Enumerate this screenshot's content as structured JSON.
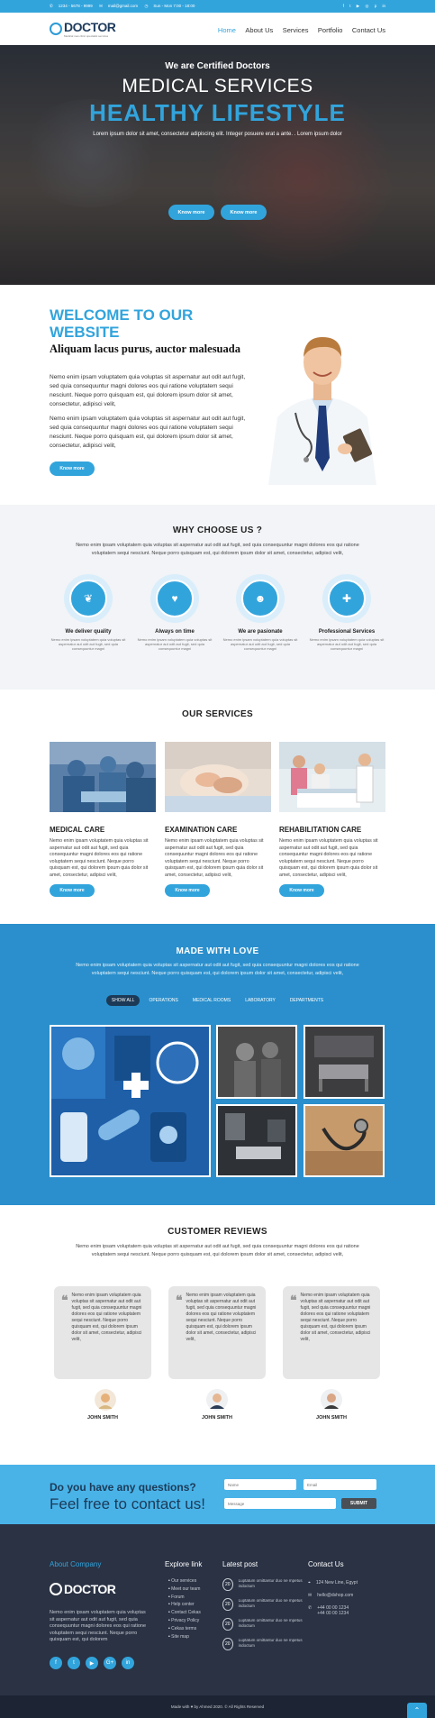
{
  "topbar": {
    "phone": "1234 - 5678 - 9999",
    "email": "mail@gmail.com",
    "hours": "Sun - Mon 7:00 - 18:00",
    "social_icons": [
      "facebook-icon",
      "twitter-icon",
      "youtube-icon",
      "instagram-icon",
      "pinterest-icon",
      "linkedin-icon"
    ]
  },
  "nav": {
    "logo": "DOCTOR",
    "logo_sub": "Medical new clinic specialist services",
    "items": [
      "Home",
      "About Us",
      "Services",
      "Portfolio",
      "Contact Us"
    ],
    "active": "Home"
  },
  "hero": {
    "kicker": "We are Certified Doctors",
    "title": "MEDICAL SERVICES",
    "title2": "HEALTHY LIFESTYLE",
    "text": "Lorem ipsum dolor sit amet, consectetur adipiscing elit. Integer posuere erat a ante. . Lorem ipsum dolor",
    "btn1": "Know more",
    "btn2": "Know more"
  },
  "welcome": {
    "title": "WELCOME TO OUR WEBSITE",
    "subtitle": "Aliquam lacus purus, auctor malesuada",
    "p1": "Nemo enim ipsam voluptatem quia voluptas sit aspernatur aut odit aut fugit, sed quia consequuntur magni dolores eos qui ratione voluptatem sequi nesciunt. Neque porro quisquam est, qui dolorem ipsum dolor sit amet, consectetur, adipisci velit,",
    "p2": "Nemo enim ipsam voluptatem quia voluptas sit aspernatur aut odit aut fugit, sed quia consequuntur magni dolores eos qui ratione voluptatem sequi nesciunt. Neque porro quisquam est, qui dolorem ipsum dolor sit amet, consectetur, adipisci velit,",
    "btn": "Know more"
  },
  "why": {
    "title": "WHY CHOOSE US ?",
    "text": "Nemo enim ipsam voluptatem quia voluptas sit aspernatur aut odit aut fugit, sed quia consequuntur magni dolores eos qui ratione voluptatem sequi nesciunt. Neque porro quisquam est, qui dolorem ipsum dolor sit amet, consectetur, adipisci velit,",
    "items": [
      {
        "title": "We deliver quality",
        "text": "Nemo enim ipsam voluptatem quia voluptas sit aspernatur aut odit aut fugit, sed quia consequuntur magni",
        "icon": "leaf-icon",
        "glyph": "❦"
      },
      {
        "title": "Always on time",
        "text": "Nemo enim ipsam voluptatem quia voluptas sit aspernatur aut odit aut fugit, sed quia consequuntur magni",
        "icon": "heartbeat-icon",
        "glyph": "♥"
      },
      {
        "title": "We are pasionate",
        "text": "Nemo enim ipsam voluptatem quia voluptas sit aspernatur aut odit aut fugit, sed quia consequuntur magni",
        "icon": "team-icon",
        "glyph": "☻"
      },
      {
        "title": "Professional Services",
        "text": "Nemo enim ipsam voluptatem quia voluptas sit aspernatur aut odit aut fugit, sed quia consequuntur magni",
        "icon": "ambulance-icon",
        "glyph": "✚"
      }
    ]
  },
  "services": {
    "title": "OUR SERVICES",
    "items": [
      {
        "title": "MEDICAL CARE",
        "text": "Nemo enim ipsam voluptatem quia voluptas sit aspernatur aut odit aut fugit, sed quia consequuntur magni dolores eos qui ratione voluptatem sequi nesciunt. Neque porro quisquam est, qui dolorem ipsum quia dolor sit amet, consectetur, adipisci velit,",
        "btn": "Know more"
      },
      {
        "title": "EXAMINATION CARE",
        "text": "Nemo enim ipsam voluptatem quia voluptas sit aspernatur aut odit aut fugit, sed quia consequuntur magni dolores eos qui ratione voluptatem sequi nesciunt. Neque porro quisquam est, qui dolorem ipsum quia dolor sit amet, consectetur, adipisci velit,",
        "btn": "Know more"
      },
      {
        "title": "REHABILITATION CARE",
        "text": "Nemo enim ipsam voluptatem quia voluptas sit aspernatur aut odit aut fugit, sed quia consequuntur magni dolores eos qui ratione voluptatem sequi nesciunt. Neque porro quisquam est, qui dolorem ipsum quia dolor sit amet, consectetur, adipisci velit,",
        "btn": "Know more"
      }
    ]
  },
  "love": {
    "title": "MADE WITH LOVE",
    "text": "Nemo enim ipsam voluptatem quia voluptas sit aspernatur aut odit aut fugit, sed quia consequuntur magni dolores eos qui ratione voluptatem sequi nesciunt. Neque porro quisquam est, qui dolorem ipsum dolor sit amet, consectetur, adipisci velit,",
    "filters": [
      "SHOW ALL",
      "OPERATIONS",
      "MEDICAL ROOMS",
      "LABORATORY",
      "DEPARTMENTS"
    ],
    "active_filter": "SHOW ALL"
  },
  "reviews": {
    "title": "CUSTOMER REVIEWS",
    "text": "Nemo enim ipsam voluptatem quia voluptas sit aspernatur aut odit aut fugit, sed quia consequuntur magni dolores eos qui ratione voluptatem sequi nesciunt. Neque porro quisquam est, qui dolorem ipsum dolor sit amet, consectetur, adipisci velit,",
    "items": [
      {
        "text": "Nemo enim ipsam voluptatem quia voluptas sit aspernatur aut odit aut fugit, sed quia consequuntur magni dolores eos qui ratione voluptatem sequi nesciunt. Neque porro quisquam est, qui dolorem ipsum dolor sit amet, consectetur, adipisci velit,",
        "name": "JOHN SMITH"
      },
      {
        "text": "Nemo enim ipsam voluptatem quia voluptas sit aspernatur aut odit aut fugit, sed quia consequuntur magni dolores eos qui ratione voluptatem sequi nesciunt. Neque porro quisquam est, qui dolorem ipsum dolor sit amet, consectetur, adipisci velit,",
        "name": "JOHN SMITH"
      },
      {
        "text": "Nemo enim ipsam voluptatem quia voluptas sit aspernatur aut odit aut fugit, sed quia consequuntur magni dolores eos qui ratione voluptatem sequi nesciunt. Neque porro quisquam est, qui dolorem ipsum dolor sit amet, consectetur, adipisci velit,",
        "name": "JOHN SMITH"
      }
    ]
  },
  "cta": {
    "title": "Do you have any questions?",
    "subtitle": "Feel free to contact us!",
    "name_placeholder": "Name",
    "email_placeholder": "Email",
    "message_placeholder": "Message",
    "submit": "SUBMIT"
  },
  "footer": {
    "about_title": "About Company",
    "logo": "DOCTOR",
    "about_text": "Nemo enim ipsam voluptatem quia voluptas sit aspernatur aut odit aut fugit, sed quia consequuntur magni dolores eos qui ratione voluptatem sequi nesciunt. Neque porro quisquam est, qui dolorem",
    "explore_title": "Explore link",
    "links": [
      "Our services",
      "Meet our team",
      "Forum",
      "Help center",
      "Contact Cekas",
      "Privacy Policy",
      "Cekas terms",
      "Site map"
    ],
    "post_title": "Latest post",
    "posts": [
      {
        "day": "20",
        "text": "Luptatum omittantur duo ne mpetus indoctum"
      },
      {
        "day": "20",
        "text": "Luptatum omittantur duo ne mpetus indoctum"
      },
      {
        "day": "20",
        "text": "Luptatum omittantur duo ne mpetus indoctum"
      },
      {
        "day": "20",
        "text": "Luptatum omittantur duo ne mpetus indoctum"
      }
    ],
    "contact_title": "Contact Us",
    "address": "124 New Line, Egypt",
    "email": "hello@dshop.com",
    "phone1": "+44 00 00 1234",
    "phone2": "+44 00 00 1234",
    "social": [
      "facebook-icon",
      "twitter-icon",
      "youtube-icon",
      "google-plus-icon",
      "linkedin-icon"
    ],
    "copyright": "Made with ♥ by Ahmed 2020. © All Rights Reserved"
  },
  "colors": {
    "accent": "#32a4dc",
    "dark": "#2a3244",
    "love_bg": "#2a8fcc"
  }
}
